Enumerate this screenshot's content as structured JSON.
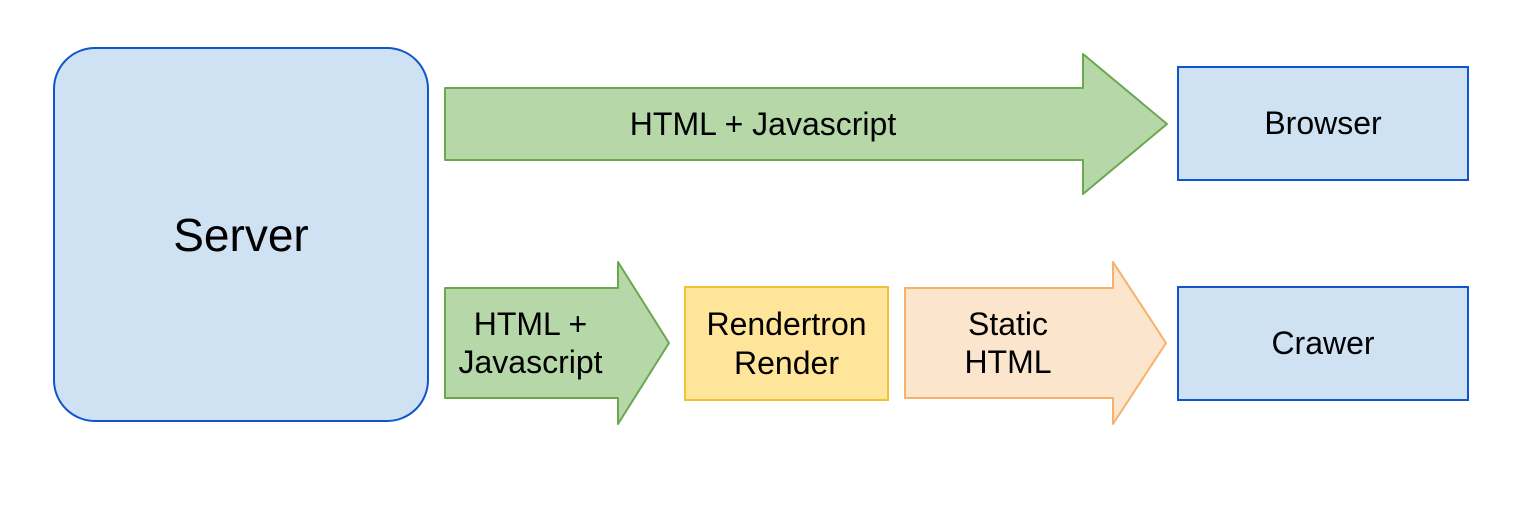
{
  "server": {
    "label": "Server"
  },
  "browser": {
    "label": "Browser"
  },
  "crawler": {
    "label": "Crawer"
  },
  "rendertron": {
    "label": "Rendertron\nRender"
  },
  "arrows": {
    "top": {
      "label": "HTML + Javascript"
    },
    "bottom_left": {
      "label": "HTML +\nJavascript"
    },
    "bottom_right": {
      "label": "Static\nHTML"
    }
  },
  "colors": {
    "blue_fill": "#cfe2f3",
    "blue_stroke": "#1155cc",
    "green_fill": "#b6d7a8",
    "green_stroke": "#6aa84f",
    "orange_fill": "#ffe599",
    "orange_stroke": "#f1c232",
    "orange_arrow_fill": "#fce5cd",
    "orange_arrow_stroke": "#f6b26b"
  }
}
